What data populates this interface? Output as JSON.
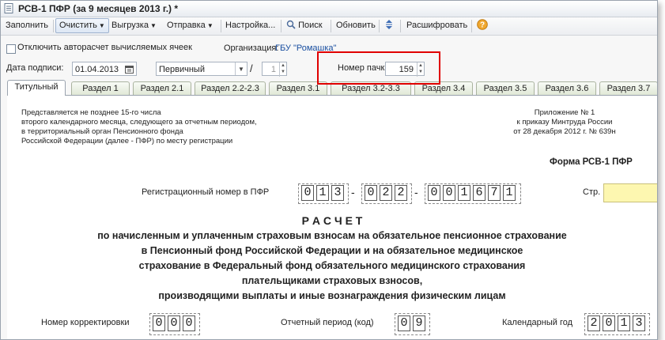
{
  "window": {
    "title": "РСВ-1 ПФР (за 9 месяцев 2013 г.) *"
  },
  "toolbar": {
    "fill": "Заполнить",
    "clear": "Очистить",
    "export": "Выгрузка",
    "send": "Отправка",
    "settings": "Настройка...",
    "search": "Поиск",
    "refresh": "Обновить",
    "decode": "Расшифровать",
    "help_icon": "help-icon"
  },
  "options": {
    "disable_autocalc": "Отключить авторасчет вычисляемых ячеек",
    "org_label": "Организация:",
    "org_value": "ГБУ \"Ромашка\""
  },
  "sign": {
    "date_label": "Дата подписи:",
    "date_value": "01.04.2013",
    "kind_value": "Первичный",
    "slash": "/",
    "corr_value": "1",
    "batch_label": "Номер пачки:",
    "batch_value": "159"
  },
  "tabs": [
    "Титульный",
    "Раздел 1",
    "Раздел 2.1",
    "Раздел 2.2-2.3",
    "Раздел 3.1",
    "Раздел 3.2-3.3",
    "Раздел 3.4",
    "Раздел 3.5",
    "Раздел 3.6",
    "Раздел 3.7"
  ],
  "form": {
    "note_lines": [
      "Представляется не позднее 15-го числа",
      "второго календарного месяца, следующего за отчетным периодом,",
      "в территориальный орган Пенсионного фонда",
      "Российской Федерации (далее - ПФР) по месту регистрации"
    ],
    "appendix_lines": [
      "Приложение № 1",
      "к приказу Минтруда России",
      "от 28 декабря 2012 г. № 639н"
    ],
    "form_name": "Форма РСВ-1 ПФР",
    "reg_label": "Регистрационный номер в ПФР",
    "reg_groups": [
      [
        "0",
        "1",
        "3"
      ],
      [
        "0",
        "2",
        "2"
      ],
      [
        "0",
        "0",
        "1",
        "6",
        "7",
        "1"
      ]
    ],
    "dash": "-",
    "page_label": "Стр.",
    "heading": "Р А С Ч Е Т",
    "title_lines": [
      "по начисленным и уплаченным страховым взносам на обязательное пенсионное страхование",
      "в Пенсионный фонд Российской Федерации и на обязательное медицинское",
      "страхование в Федеральный фонд обязательного медицинского страхования",
      "плательщиками страховых взносов,",
      "производящими выплаты и иные вознаграждения физическим лицам"
    ],
    "corr_label": "Номер корректировки",
    "corr_cells": [
      "0",
      "0",
      "0"
    ],
    "period_label": "Отчетный период (код)",
    "period_cells": [
      "0",
      "9"
    ],
    "year_label": "Календарный год",
    "year_cells": [
      "2",
      "0",
      "1",
      "3"
    ]
  }
}
